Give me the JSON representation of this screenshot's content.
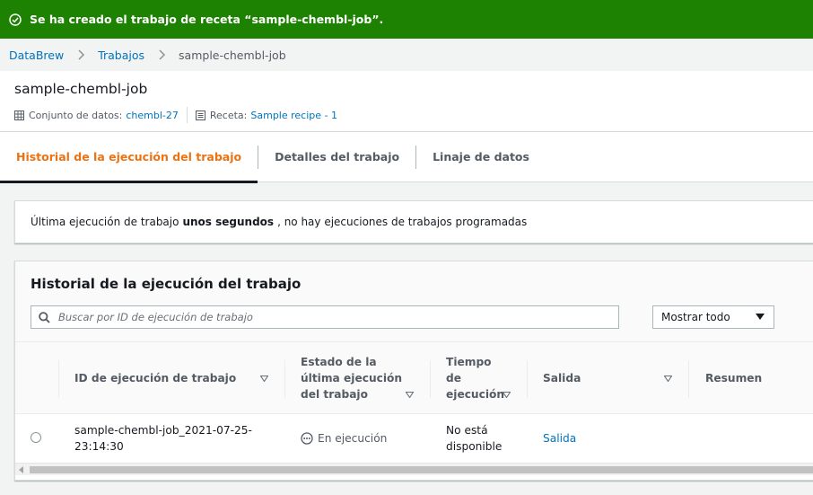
{
  "flash": {
    "message": "Se ha creado el trabajo de receta “sample-chembl-job”."
  },
  "breadcrumb": {
    "items": [
      "DataBrew",
      "Trabajos"
    ],
    "current": "sample-chembl-job"
  },
  "header": {
    "title": "sample-chembl-job",
    "dataset_label": "Conjunto de datos:",
    "dataset_value": "chembl-27",
    "recipe_label": "Receta:",
    "recipe_value": "Sample recipe - 1"
  },
  "tabs": [
    {
      "label": "Historial de la ejecución del trabajo",
      "active": true
    },
    {
      "label": "Detalles del trabajo",
      "active": false
    },
    {
      "label": "Linaje de datos",
      "active": false
    }
  ],
  "notice": {
    "prefix": "Última ejecución de trabajo",
    "bold": "unos segundos",
    "suffix": ", no hay ejecuciones de trabajos programadas"
  },
  "history": {
    "title": "Historial de la ejecución del trabajo",
    "search_placeholder": "Buscar por ID de ejecución de trabajo",
    "filter_selected": "Mostrar todo",
    "columns": {
      "run_id": "ID de ejecución de trabajo",
      "status_l1": "Estado de la",
      "status_l2": "última ejecución",
      "status_l3": "del trabajo",
      "time_l1": "Tiempo",
      "time_l2": "de",
      "time_l3": "ejecución",
      "output": "Salida",
      "summary": "Resumen"
    },
    "rows": [
      {
        "run_id_l1": "sample-chembl-job_2021-07-25-",
        "run_id_l2": "23:14:30",
        "status": "En ejecución",
        "time_l1": "No está",
        "time_l2": "disponible",
        "output": "Salida"
      }
    ]
  },
  "colors": {
    "success": "#1d8102",
    "link": "#0073bb",
    "active_tab": "#ec7211"
  }
}
